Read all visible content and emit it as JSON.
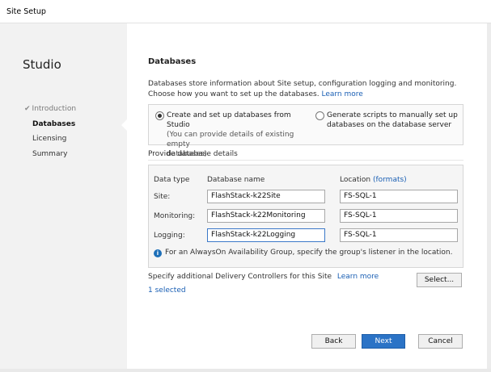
{
  "window": {
    "title": "Site Setup"
  },
  "sidebar": {
    "product": "Studio",
    "items": [
      {
        "label": "Introduction",
        "state": "done",
        "icon": "checkmark-icon"
      },
      {
        "label": "Databases",
        "state": "active"
      },
      {
        "label": "Licensing",
        "state": "pending"
      },
      {
        "label": "Summary",
        "state": "pending"
      }
    ]
  },
  "main": {
    "heading": "Databases",
    "description": "Databases store information about Site setup, configuration logging and monitoring. Choose how you want to set up the databases.",
    "learn_more": "Learn more",
    "options": [
      {
        "label_line1": "Create and set up databases from Studio",
        "label_line2": "(You can provide details of existing empty",
        "label_line3": "databases)",
        "selected": true
      },
      {
        "label_line1": "Generate scripts to manually set up",
        "label_line2": "databases on the database server",
        "selected": false
      }
    ],
    "details": {
      "section_label": "Provide database details",
      "headers": {
        "type": "Data type",
        "name": "Database name",
        "location": "Location",
        "formats_link": "(formats)"
      },
      "rows": [
        {
          "type": "Site:",
          "name": "FlashStack-k22Site",
          "location": "FS-SQL-1"
        },
        {
          "type": "Monitoring:",
          "name": "FlashStack-k22Monitoring",
          "location": "FS-SQL-1"
        },
        {
          "type": "Logging:",
          "name": "FlashStack-k22Logging",
          "location": "FS-SQL-1"
        }
      ],
      "info": "For an AlwaysOn Availability Group, specify the group's listener in the location."
    },
    "controllers": {
      "label": "Specify additional Delivery Controllers for this Site",
      "learn_more": "Learn more",
      "select_button": "Select...",
      "selected_count": "1 selected"
    }
  },
  "footer": {
    "back": "Back",
    "next": "Next",
    "cancel": "Cancel"
  },
  "colors": {
    "accent": "#2b73c6",
    "link": "#1a5fb4",
    "sidebar_bg": "#f2f2f2"
  }
}
